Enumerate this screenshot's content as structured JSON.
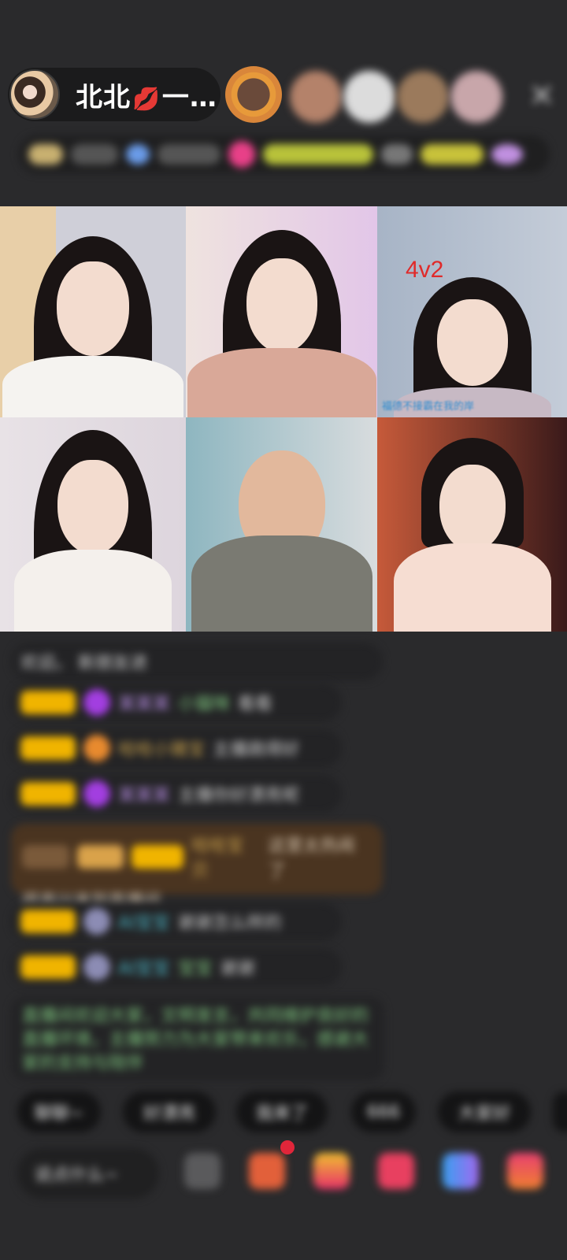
{
  "header": {
    "host_name": "北北",
    "host_emoji": "💋",
    "host_suffix": "一…",
    "close_symbol": "✕"
  },
  "video_grid": {
    "tiles": [
      {
        "label": ""
      },
      {
        "label": ""
      },
      {
        "label": "4v2",
        "caption": "福德不接霸在我的岸"
      },
      {
        "label": ""
      },
      {
        "label": ""
      },
      {
        "label": ""
      }
    ]
  },
  "chat": {
    "messages": [
      {
        "text": "欢迎。 新朋友进"
      },
      {
        "badge": "",
        "name": "某某某",
        "target": "小猫咪",
        "text": "看看"
      },
      {
        "badge": "",
        "name": "哈哈小猪宝",
        "text": "主播跳得好"
      },
      {
        "badge": "",
        "name": "某某某",
        "text": "主播你好漂亮呢"
      },
      {
        "badge": "",
        "name": "哈哈宝贝",
        "text": "这里太热闹了",
        "line2": "很高兴来到直播间"
      },
      {
        "badge": "",
        "name": "AI宝宝",
        "text": "谢谢怎么样的"
      },
      {
        "badge": "",
        "name": "AI宝宝",
        "target": "宝宝",
        "text": "谢谢"
      }
    ],
    "notice": "直播间欢迎大家，文明发言，共同维护良好的直播环境，主播努力为大家带来欢乐，感谢大家的支持与陪伴"
  },
  "quick_replies": [
    "聊聊~",
    "好漂亮",
    "我来了",
    "666",
    "大家好"
  ],
  "bottom_bar": {
    "input_placeholder": "说点什么~"
  },
  "colors": {
    "background": "#2a2a2c",
    "badge_gold": "#f0b400",
    "gem_purple": "#a23ee0",
    "gem_orange": "#e88a2e",
    "promo_brown": "#4a3420",
    "notice_green": "#7ec67e"
  }
}
